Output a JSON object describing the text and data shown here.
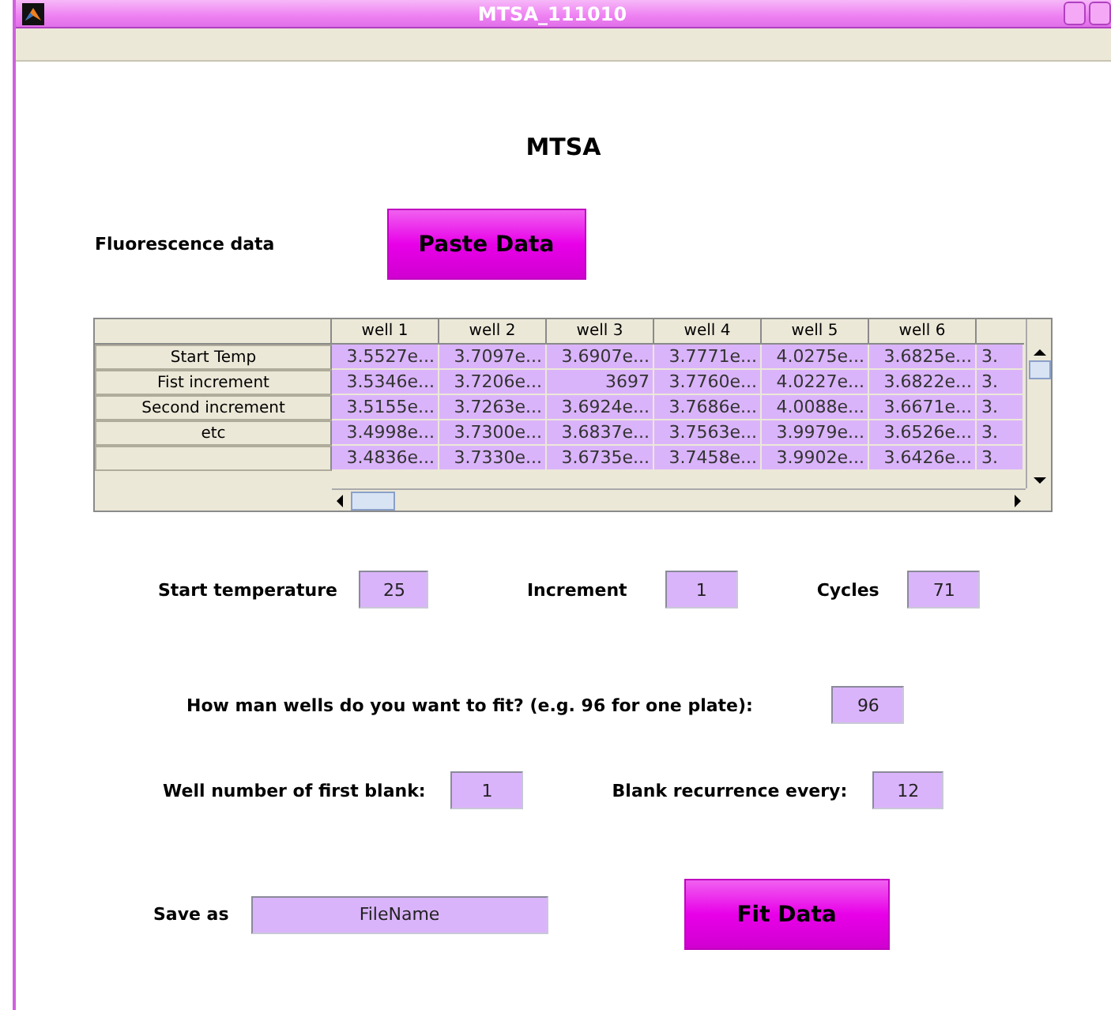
{
  "window": {
    "title": "MTSA_111010"
  },
  "heading": "MTSA",
  "fluorescence": {
    "label": "Fluorescence data",
    "button": "Paste Data"
  },
  "table": {
    "columns": [
      "well 1",
      "well 2",
      "well 3",
      "well 4",
      "well 5",
      "well 6"
    ],
    "rows": [
      {
        "header": "Start Temp",
        "cells": [
          "3.5527e...",
          "3.7097e...",
          "3.6907e...",
          "3.7771e...",
          "4.0275e...",
          "3.6825e..."
        ],
        "cut_cell": "3."
      },
      {
        "header": "Fist increment",
        "cells": [
          "3.5346e...",
          "3.7206e...",
          "3697",
          "3.7760e...",
          "4.0227e...",
          "3.6822e..."
        ],
        "cut_cell": "3."
      },
      {
        "header": "Second increment",
        "cells": [
          "3.5155e...",
          "3.7263e...",
          "3.6924e...",
          "3.7686e...",
          "4.0088e...",
          "3.6671e..."
        ],
        "cut_cell": "3."
      },
      {
        "header": "etc",
        "cells": [
          "3.4998e...",
          "3.7300e...",
          "3.6837e...",
          "3.7563e...",
          "3.9979e...",
          "3.6526e..."
        ],
        "cut_cell": "3."
      },
      {
        "header": "",
        "cells": [
          "3.4836e...",
          "3.7330e...",
          "3.6735e...",
          "3.7458e...",
          "3.9902e...",
          "3.6426e..."
        ],
        "cut_cell": "3."
      }
    ]
  },
  "cycle_fields": [
    {
      "label": "Start temperature",
      "value": "25"
    },
    {
      "label": "Increment",
      "value": "1"
    },
    {
      "label": "Cycles",
      "value": "71"
    }
  ],
  "wells": {
    "label": "How man wells do you want to fit? (e.g. 96 for one plate):",
    "value": "96"
  },
  "blanks": [
    {
      "label": "Well number of first blank:",
      "value": "1"
    },
    {
      "label": "Blank recurrence every:",
      "value": "12"
    }
  ],
  "save": {
    "label": "Save as",
    "value": "FileName"
  },
  "fit_button": "Fit Data"
}
